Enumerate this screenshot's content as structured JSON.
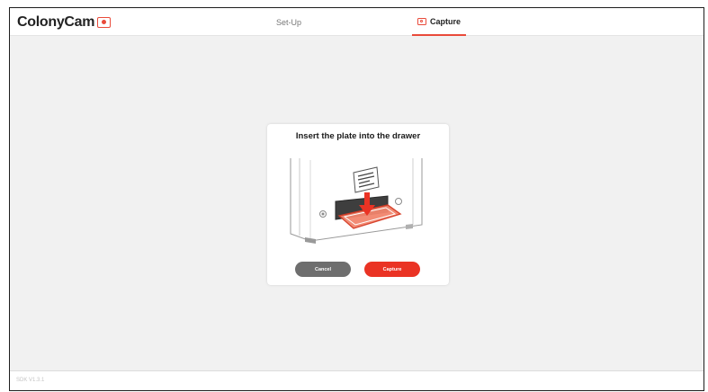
{
  "app": {
    "brand": "ColonyCam",
    "brand_color": "#e94a3a"
  },
  "nav": {
    "tabs": [
      {
        "label": "Set-Up",
        "active": false
      },
      {
        "label": "Capture",
        "active": true,
        "icon": "camera-icon"
      }
    ]
  },
  "modal": {
    "title": "Insert the plate into the drawer",
    "illustration": "plate-drawer-illustration",
    "cancel_label": "Cancel",
    "capture_label": "Capture",
    "capture_color": "#ea3324",
    "cancel_color": "#6e6e6e"
  },
  "footer": {
    "version": "SDK V1.3.1"
  }
}
